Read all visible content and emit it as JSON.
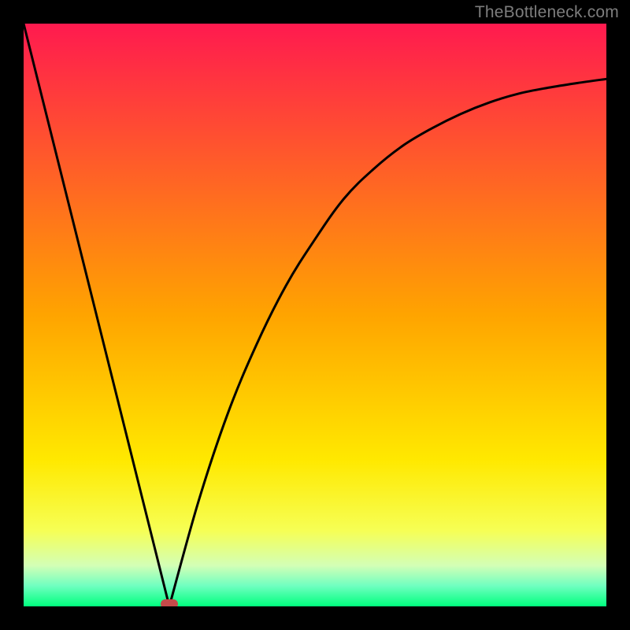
{
  "watermark": "TheBottleneck.com",
  "colors": {
    "bg": "#000000",
    "marker": "#c54a4a",
    "curve": "#000000",
    "gradient_stops": [
      {
        "offset": 0.0,
        "color": "#ff1a4f"
      },
      {
        "offset": 0.5,
        "color": "#ffa400"
      },
      {
        "offset": 0.75,
        "color": "#ffe900"
      },
      {
        "offset": 0.87,
        "color": "#f6ff55"
      },
      {
        "offset": 0.93,
        "color": "#d3ffb6"
      },
      {
        "offset": 0.965,
        "color": "#6fffc0"
      },
      {
        "offset": 1.0,
        "color": "#00ff7d"
      }
    ]
  },
  "chart_data": {
    "type": "line",
    "title": "",
    "xlabel": "",
    "ylabel": "",
    "xlim": [
      0,
      100
    ],
    "ylim": [
      0,
      100
    ],
    "x_optimum": 25,
    "series": [
      {
        "name": "bottleneck-curve",
        "x": [
          0,
          5,
          10,
          15,
          20,
          25,
          30,
          35,
          40,
          45,
          50,
          55,
          60,
          65,
          70,
          75,
          80,
          85,
          90,
          95,
          100
        ],
        "values": [
          100,
          80,
          60,
          40,
          20,
          0,
          18,
          33,
          45,
          55,
          63,
          70,
          75,
          79,
          82,
          84.5,
          86.5,
          88,
          89,
          89.8,
          90.5
        ]
      }
    ],
    "annotations": [
      {
        "name": "optimum-marker",
        "x": 25,
        "y": 0
      }
    ]
  }
}
